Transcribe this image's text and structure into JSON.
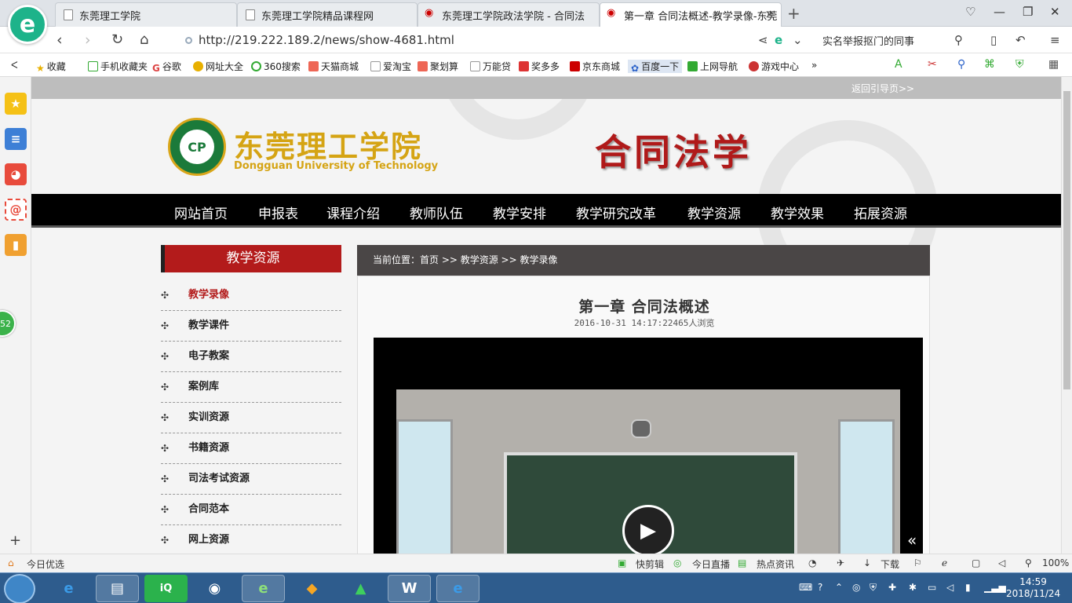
{
  "browser": {
    "logo_letter": "e",
    "tabs": [
      {
        "label": "东莞理工学院"
      },
      {
        "label": "东莞理工学院精品课程网"
      },
      {
        "label": "东莞理工学院政法学院 - 合同法"
      },
      {
        "label": "第一章 合同法概述-教学录像-东莞"
      }
    ],
    "url": "http://219.222.189.2/news/show-4681.html",
    "search_text": "实名举报抠门的同事",
    "bookmarks": [
      "收藏",
      "手机收藏夹",
      "谷歌",
      "网址大全",
      "360搜索",
      "天猫商城",
      "爱淘宝",
      "聚划算",
      "万能贷",
      "奖多多",
      "京东商城",
      "百度一下",
      "上网导航",
      "游戏中心"
    ]
  },
  "sidebar_badge": "52",
  "page": {
    "back_link": "返回引导页>>",
    "school_name_cn": "东莞理工学院",
    "school_name_en": "Dongguan University of Technology",
    "emblem_text": "CP",
    "course_title": "合同法学",
    "main_nav": [
      "网站首页",
      "申报表",
      "课程介绍",
      "教师队伍",
      "教学安排",
      "教学研究改革",
      "教学资源",
      "教学效果",
      "拓展资源"
    ],
    "left_heading": "教学资源",
    "left_menu": [
      "教学录像",
      "教学课件",
      "电子教案",
      "案例库",
      "实训资源",
      "书籍资源",
      "司法考试资源",
      "合同范本",
      "网上资源"
    ],
    "breadcrumb": "当前位置：首页 >> 教学资源 >> 教学录像",
    "article_title": "第一章  合同法概述",
    "article_meta": "2016-10-31 14:17:22465人浏览"
  },
  "statusbar": {
    "left": "今日优选",
    "items": [
      "快剪辑",
      "今日直播",
      "热点资讯",
      "下载"
    ],
    "zoom": "100%"
  },
  "taskbar": {
    "time": "14:59",
    "date": "2018/11/24"
  }
}
